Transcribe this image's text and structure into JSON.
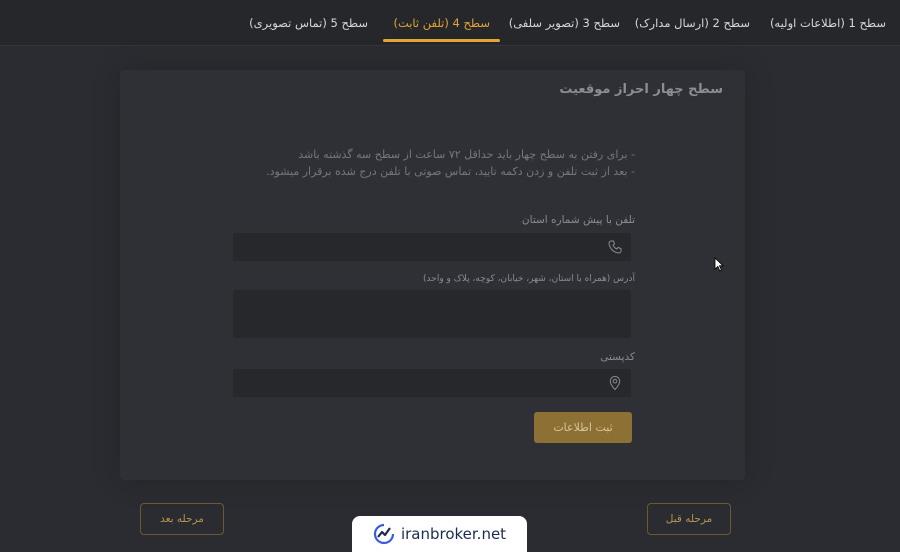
{
  "tabs": [
    {
      "label": "سطح 1 (اطلاعات اولیه)",
      "active": false
    },
    {
      "label": "سطح 2 (ارسال مدارک)",
      "active": false
    },
    {
      "label": "سطح 3 (تصویر سلفی)",
      "active": false
    },
    {
      "label": "سطح 4 (تلفن ثابت)",
      "active": true
    },
    {
      "label": "سطح 5 (تماس تصویری)",
      "active": false
    }
  ],
  "card": {
    "title": "سطح چهار احراز موقعیت",
    "info_lines": [
      "- برای رفتن به سطح چهار باید حداقل ۷۲ ساعت از سطح سه گذشته باشد",
      "- بعد از ثبت تلفن و زدن دکمه تایید، تماس صوتی با تلفن درج شده برقرار میشود."
    ],
    "phone_label": "تلفن با پیش شماره استان",
    "phone_value": "",
    "address_label": "آدرس (همراه با استان، شهر، خیابان، کوچه، پلاک و واحد)",
    "address_value": "",
    "postal_label": "کدپستی",
    "postal_value": "",
    "submit_label": "ثبت اطلاعات"
  },
  "nav": {
    "prev_label": "مرحله قبل",
    "next_label": "مرحله بعد"
  },
  "watermark": {
    "text": "iranbroker.net"
  },
  "colors": {
    "accent": "#e3a534",
    "background": "#2b2c31",
    "card": "#2f3035"
  }
}
